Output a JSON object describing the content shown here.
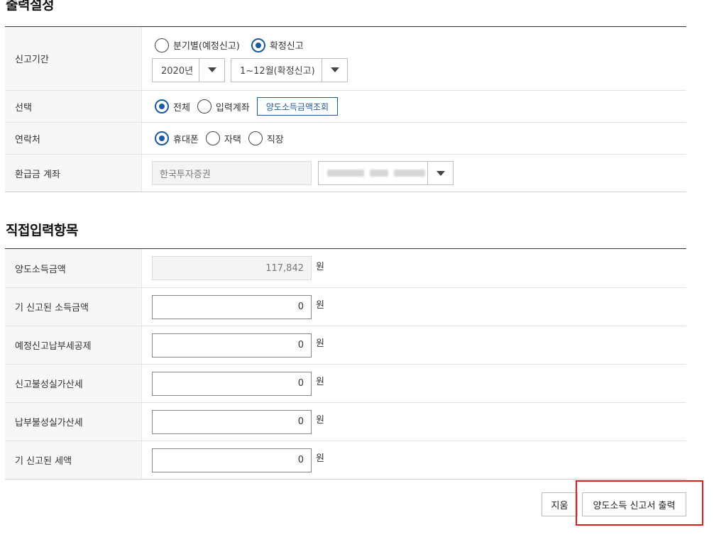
{
  "output_settings": {
    "title": "출력설정",
    "report_period": {
      "label": "신고기간",
      "radio_quarterly": "분기별(예정신고)",
      "radio_final": "확정신고",
      "selected": "확정신고",
      "year_select": "2020년",
      "month_select": "1~12월(확정신고)"
    },
    "selection": {
      "label": "선택",
      "radio_all": "전체",
      "radio_input_account": "입력계좌",
      "selected": "전체",
      "lookup_button": "양도소득금액조회"
    },
    "contact": {
      "label": "연락처",
      "radio_mobile": "휴대폰",
      "radio_home": "자택",
      "radio_work": "직장",
      "selected": "휴대폰"
    },
    "refund_account": {
      "label": "환급금 계좌",
      "bank": "한국투자증권"
    }
  },
  "direct_input": {
    "title": "직접입력항목",
    "unit": "원",
    "rows": [
      {
        "label": "양도소득금액",
        "value": "117,842",
        "readonly": true
      },
      {
        "label": "기 신고된 소득금액",
        "value": "0"
      },
      {
        "label": "예정신고납부세공제",
        "value": "0"
      },
      {
        "label": "신고불성실가산세",
        "value": "0"
      },
      {
        "label": "납부불성실가산세",
        "value": "0"
      },
      {
        "label": "기 신고된 세액",
        "value": "0"
      }
    ]
  },
  "actions": {
    "clear_button": "지움",
    "print_button": "양도소득 신고서 출력",
    "highlight_color": "#e01e1e"
  },
  "colors": {
    "accent": "#1a5aa0"
  }
}
